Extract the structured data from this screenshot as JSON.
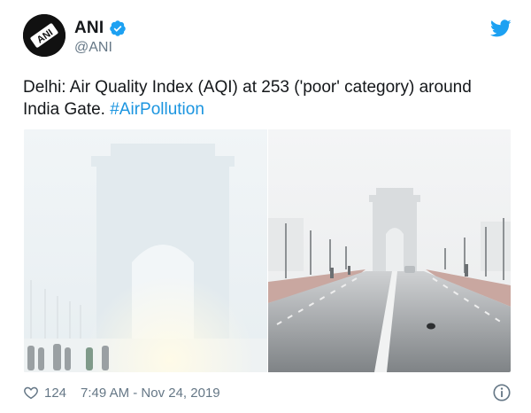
{
  "author": {
    "display_name": "ANI",
    "handle": "@ANI",
    "avatar_text": "ANI",
    "verified": true
  },
  "tweet": {
    "text_before": "Delhi: Air Quality Index (AQI) at 253 ('poor' category) around India Gate. ",
    "hashtag": "#AirPollution"
  },
  "media": {
    "images": [
      {
        "icon": "smoggy-india-gate-photo"
      },
      {
        "icon": "rajpath-india-gate-photo"
      }
    ]
  },
  "footer": {
    "like_count": "124",
    "timestamp": "7:49 AM - Nov 24, 2019"
  },
  "colors": {
    "link": "#1b95e0",
    "text": "#14171a",
    "muted": "#657786",
    "twitter_blue": "#1da1f2"
  },
  "icons": [
    "verified-badge-icon",
    "twitter-bird-icon",
    "heart-icon",
    "info-icon"
  ]
}
